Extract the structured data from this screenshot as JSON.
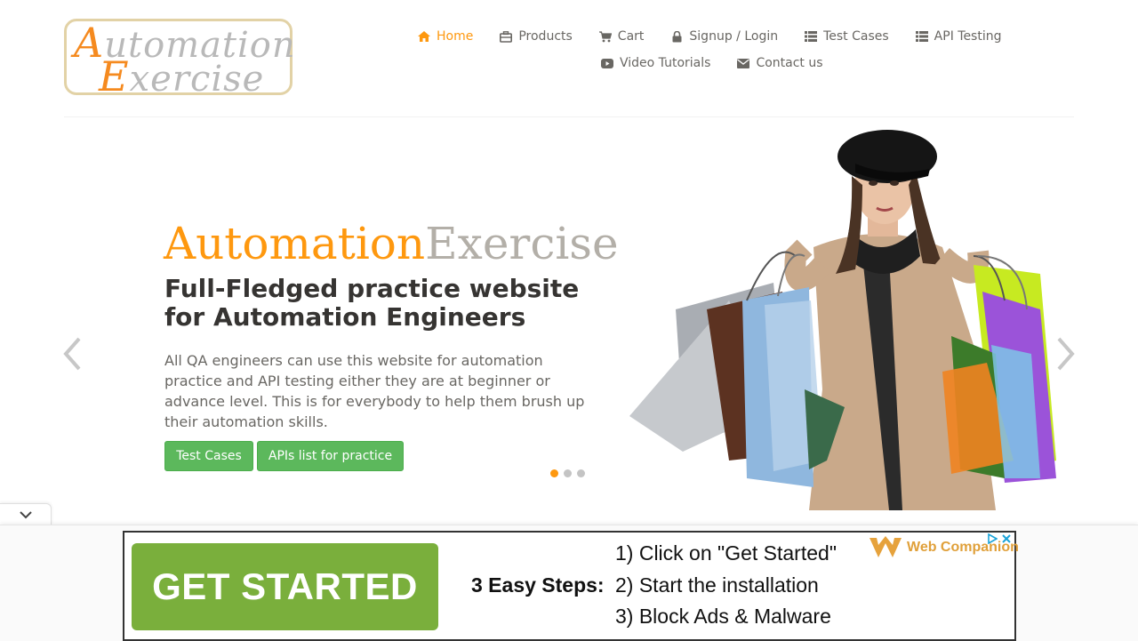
{
  "logo": {
    "line1_cap": "A",
    "line1_rest": "utomation",
    "line2_cap": "E",
    "line2_rest": "xercise"
  },
  "nav": {
    "items": [
      {
        "label": "Home",
        "icon": "home-icon",
        "active": true
      },
      {
        "label": "Products",
        "icon": "briefcase-icon"
      },
      {
        "label": "Cart",
        "icon": "cart-icon"
      },
      {
        "label": "Signup / Login",
        "icon": "lock-icon"
      },
      {
        "label": "Test Cases",
        "icon": "list-icon"
      },
      {
        "label": "API Testing",
        "icon": "list-icon"
      },
      {
        "label": "Video Tutorials",
        "icon": "youtube-icon"
      },
      {
        "label": "Contact us",
        "icon": "envelope-icon"
      }
    ]
  },
  "slider": {
    "brand_a": "Automation",
    "brand_b": "Exercise",
    "headline": "Full-Fledged practice website for Automation Engineers",
    "description": "All QA engineers can use this website for automation practice and API testing either they are at beginner or advance level. This is for everybody to help them brush up their automation skills.",
    "button_test_cases": "Test Cases",
    "button_apis": "APIs list for practice",
    "active_slide": 1,
    "slide_count": 3
  },
  "ad": {
    "cta": "GET STARTED",
    "steps_title": "3 Easy Steps:",
    "steps": [
      "1) Click on \"Get Started\"",
      "2) Start the installation",
      "3) Block Ads & Malware"
    ],
    "brand": "Web Companion"
  },
  "colors": {
    "accent": "#fe980f",
    "button": "#5cb85c",
    "text": "#696763"
  }
}
